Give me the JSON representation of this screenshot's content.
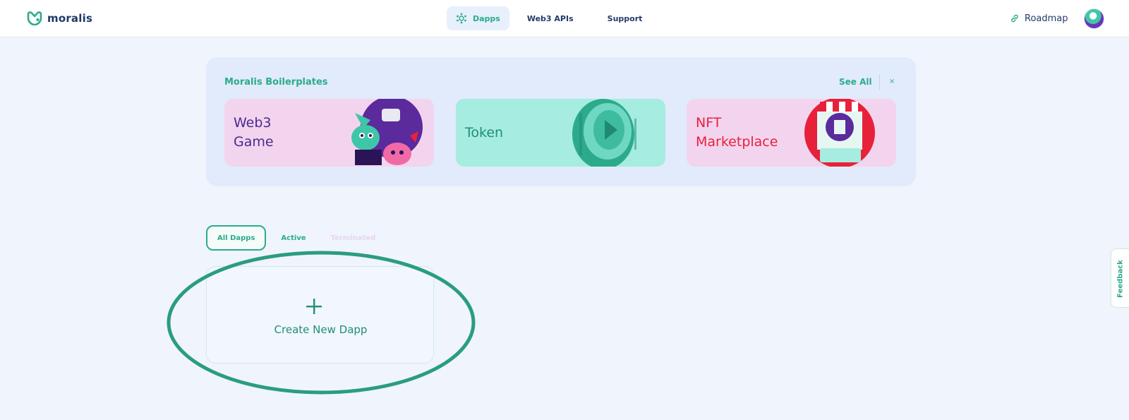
{
  "header": {
    "brand": "moralis",
    "nav": [
      {
        "label": "Dapps",
        "icon": "dapps-icon",
        "active": true
      },
      {
        "label": "Web3 APIs"
      },
      {
        "label": "Support"
      }
    ],
    "roadmap_label": "Roadmap"
  },
  "boilerplates": {
    "title": "Moralis Boilerplates",
    "see_all": "See All",
    "close": "×",
    "cards": [
      {
        "line1": "Web3",
        "line2": "Game",
        "art": "web3-game-characters"
      },
      {
        "line1": "Token",
        "line2": "",
        "art": "token-coin"
      },
      {
        "line1": "NFT",
        "line2": "Marketplace",
        "art": "nft-buy-box"
      }
    ]
  },
  "filters": {
    "all": "All Dapps",
    "active": "Active",
    "terminated": "Terminated"
  },
  "create": {
    "plus": "+",
    "label": "Create New Dapp"
  },
  "feedback": "Feedback",
  "colors": {
    "accent": "#2cab8c",
    "navy": "#243b69",
    "page_bg": "#f0f4fc",
    "panel_bg": "#e1ebfb",
    "pink_card": "#f3d4ee",
    "mint_card": "#a6ece0",
    "purple_text": "#4a2a8f",
    "red_text": "#e8213b",
    "highlight": "#2a9d7e"
  }
}
